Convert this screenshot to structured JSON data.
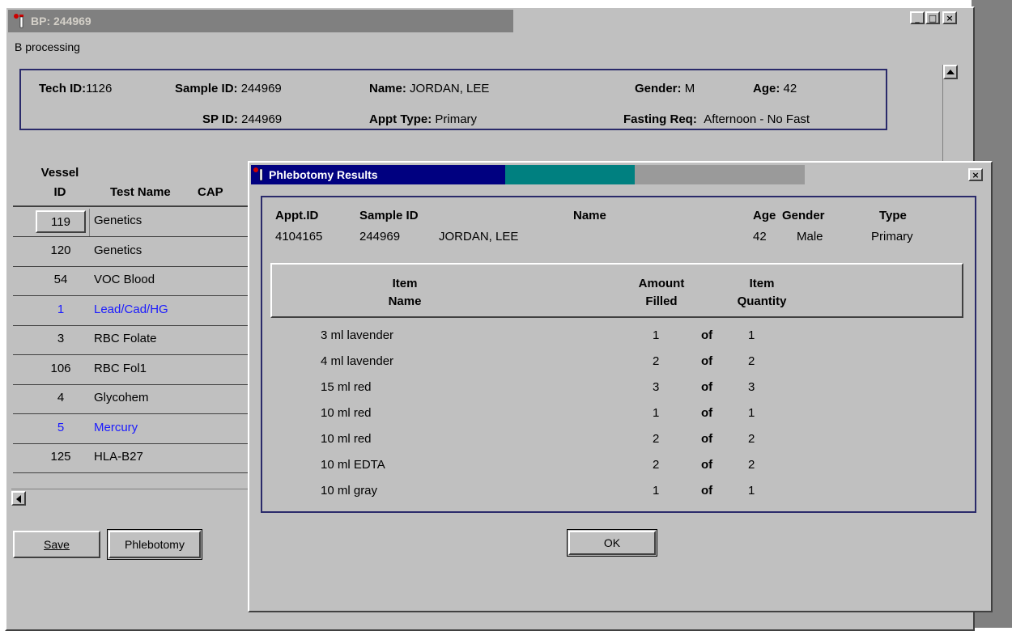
{
  "window": {
    "title": "BP: 244969",
    "subtitle": "B processing",
    "controls": [
      "_",
      "□",
      "×"
    ]
  },
  "header": {
    "tech_id_label": "Tech ID:",
    "tech_id": "1126",
    "sample_id_label": "Sample ID:",
    "sample_id": "244969",
    "name_label": "Name:",
    "name": "JORDAN, LEE",
    "gender_label": "Gender:",
    "gender": "M",
    "age_label": "Age:",
    "age": "42",
    "sp_id_label": "SP ID:",
    "sp_id": "244969",
    "appt_type_label": "Appt Type:",
    "appt_type": "Primary",
    "fasting_label": "Fasting Req:",
    "fasting": "Afternoon - No Fast"
  },
  "grid": {
    "col_vessel_1": "Vessel",
    "col_vessel_2": "ID",
    "col_test": "Test Name",
    "col_cap": "CAP",
    "rows": [
      {
        "id": "119",
        "name": "Genetics",
        "color": "#000000"
      },
      {
        "id": "120",
        "name": "Genetics",
        "color": "#000000"
      },
      {
        "id": "54",
        "name": "VOC Blood",
        "color": "#000000"
      },
      {
        "id": "1",
        "name": "Lead/Cad/HG",
        "color": "#1a1aff"
      },
      {
        "id": "3",
        "name": "RBC Folate",
        "color": "#000000"
      },
      {
        "id": "106",
        "name": "RBC Fol1",
        "color": "#000000"
      },
      {
        "id": "4",
        "name": "Glycohem",
        "color": "#000000"
      },
      {
        "id": "5",
        "name": "Mercury",
        "color": "#1a1aff"
      },
      {
        "id": "125",
        "name": "HLA-B27",
        "color": "#000000"
      }
    ]
  },
  "buttons": {
    "save": "Save",
    "phlebotomy": "Phlebotomy",
    "ok": "OK",
    "dialog_close": "×"
  },
  "dialog": {
    "title": "Phlebotomy Results",
    "col_appt": "Appt.ID",
    "col_sample": "Sample ID",
    "col_name": "Name",
    "col_age": "Age",
    "col_gender": "Gender",
    "col_type": "Type",
    "appt_id": "4104165",
    "sample_id": "244969",
    "name": "JORDAN, LEE",
    "age": "42",
    "gender": "Male",
    "type": "Primary",
    "item_name_1": "Item",
    "item_name_2": "Name",
    "amount_1": "Amount",
    "amount_2": "Filled",
    "qty_1": "Item",
    "qty_2": "Quantity",
    "of_label": "of",
    "items": [
      {
        "name": "3 ml lavender",
        "filled": "1",
        "quantity": "1"
      },
      {
        "name": "4 ml lavender",
        "filled": "2",
        "quantity": "2"
      },
      {
        "name": "15 ml red",
        "filled": "3",
        "quantity": "3"
      },
      {
        "name": "10 ml red",
        "filled": "1",
        "quantity": "1"
      },
      {
        "name": "10 ml red",
        "filled": "2",
        "quantity": "2"
      },
      {
        "name": "10 ml EDTA",
        "filled": "2",
        "quantity": "2"
      },
      {
        "name": "10 ml gray",
        "filled": "1",
        "quantity": "1"
      }
    ]
  },
  "colors": {
    "dialog_title_bg": "#000080",
    "accent_teal": "#008080",
    "link_blue": "#1a1aff"
  }
}
